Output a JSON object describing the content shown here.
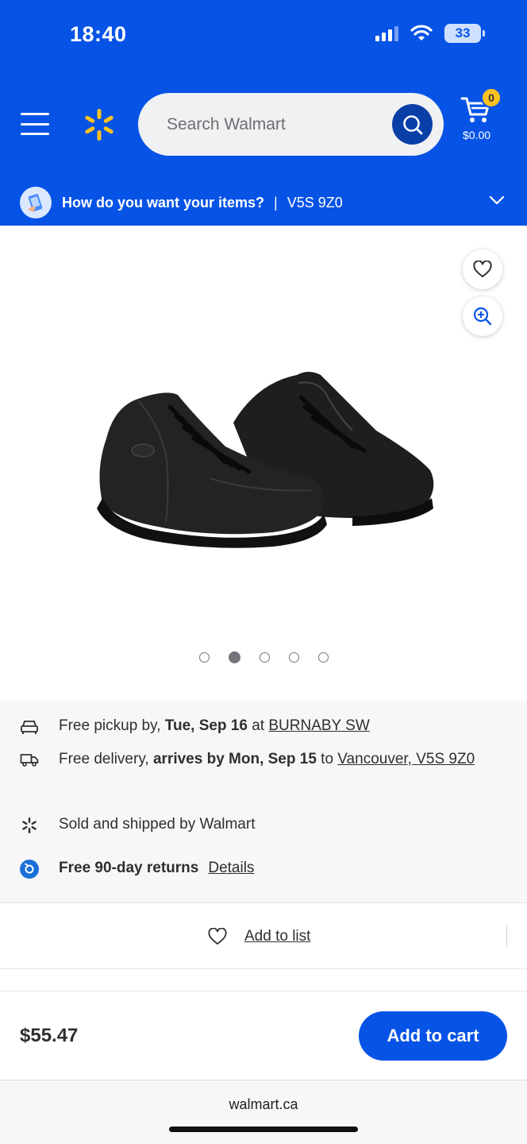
{
  "status_bar": {
    "time": "18:40",
    "battery": "33",
    "icons": [
      "signal-icon",
      "wifi-icon",
      "battery-icon"
    ]
  },
  "header": {
    "search": {
      "placeholder": "Search Walmart"
    },
    "cart": {
      "count": "0",
      "total": "$0.00"
    },
    "colors": {
      "brand_blue": "#0653e6",
      "spark_yellow": "#ffc220",
      "search_button": "#0b3fa8"
    }
  },
  "location": {
    "question": "How do you want your items?",
    "separator": "|",
    "postal_code": "V5S 9Z0"
  },
  "product": {
    "image_alt": "Black leather work shoes",
    "carousel": {
      "total": 5,
      "active_index": 2
    }
  },
  "fulfillment": {
    "pickup": {
      "prefix": "Free pickup by, ",
      "date": "Tue, Sep 16",
      "middle": " at ",
      "store": "BURNABY SW"
    },
    "delivery": {
      "prefix": "Free delivery, ",
      "date": "arrives by Mon, Sep 15",
      "middle": " to ",
      "address": "Vancouver, V5S 9Z0"
    },
    "seller": "Sold and shipped by Walmart",
    "returns": {
      "label": "Free 90-day returns",
      "link": "Details"
    }
  },
  "add_to_list": {
    "label": "Add to list"
  },
  "buy": {
    "price": "$55.47",
    "button": "Add to cart"
  },
  "browser": {
    "url": "walmart.ca"
  }
}
